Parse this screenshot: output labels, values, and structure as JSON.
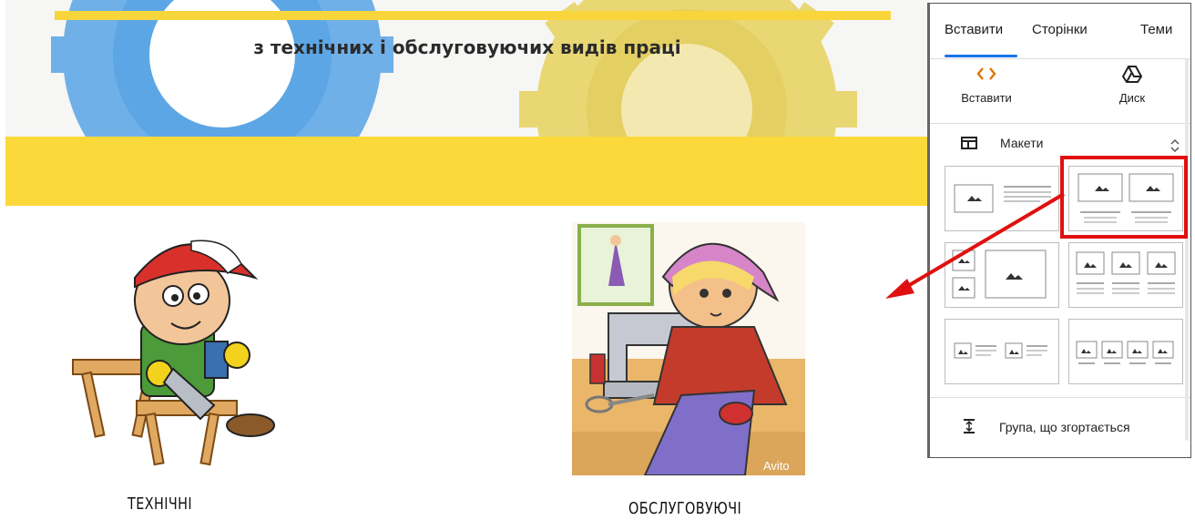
{
  "banner": {
    "title": "з технічних і обслуговуючих видів праці"
  },
  "cards": [
    {
      "caption": "ТЕХНІЧНІ"
    },
    {
      "caption": "ОБСЛУГОВУЮЧІ",
      "watermark": "Avito"
    }
  ],
  "panel": {
    "tabs": [
      {
        "label": "Вставити"
      },
      {
        "label": "Сторінки"
      },
      {
        "label": "Теми"
      }
    ],
    "quick_actions": [
      {
        "label": "Вставити",
        "icon": "code-icon"
      },
      {
        "label": "Диск",
        "icon": "drive-icon"
      }
    ],
    "layouts_section": {
      "label": "Макети"
    },
    "collapsible_group": {
      "label": "Група, що згортається"
    }
  },
  "colors": {
    "accent_blue": "#1a73e8",
    "highlight_red": "#e01010",
    "banner_yellow": "#fcd93a",
    "gear_blue": "#6fb0e8",
    "gear_yellow": "#e9d774"
  }
}
